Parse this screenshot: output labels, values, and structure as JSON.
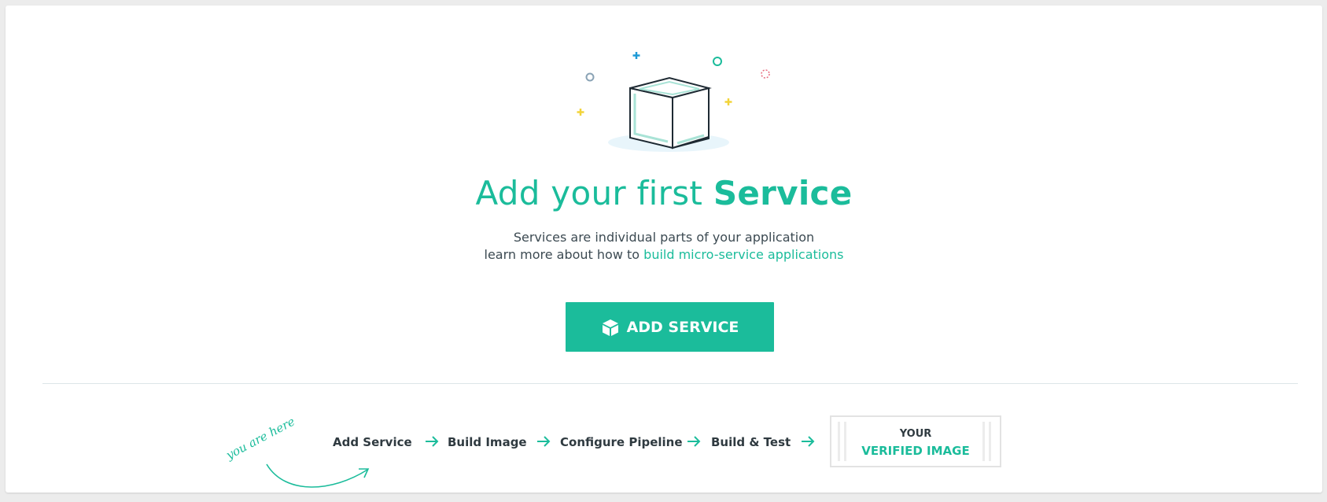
{
  "empty_state": {
    "title_prefix": "Add your first",
    "title_emphasis": "Service",
    "description_line1": "Services are individual parts of your application",
    "description_line2_prefix": "learn more about how to",
    "description_link": "build micro-service applications",
    "add_button_label": "ADD SERVICE",
    "add_button_icon": "cube-icon"
  },
  "progress": {
    "you_are_here_note": "you are here",
    "steps": [
      "Add Service",
      "Build Image",
      "Configure Pipeline",
      "Build & Test"
    ],
    "final": {
      "line1": "YOUR",
      "line2": "VERIFIED IMAGE"
    }
  },
  "colors": {
    "accent": "#1bbc9b",
    "text": "#2f3a40",
    "background": "#ececec"
  }
}
